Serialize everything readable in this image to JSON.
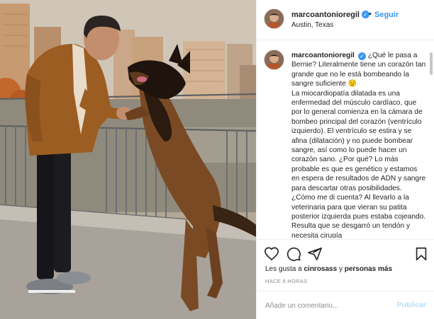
{
  "post": {
    "username": "marcoantonioregil",
    "follow_label": "Seguir",
    "separator": "•",
    "location": "Austin, Texas",
    "caption_parts": [
      "¿Qué le pasa a Bernie? Literalmente tiene un corazón tan grande que no le está bombeando la sangre suficiente 😟",
      "La miocardiopatía dilatada es una enfermedad del músculo cardíaco, que por lo general comienza en la cámara de bombeo principal del corazón (ventrículo izquierdo). El ventrículo se estira y se afina (dilatación) y no puede bombear sangre, así como lo puede hacer un corazón sano. ¿Por qué? Lo más probable es que es genético y estamos en espera de resultados de ADN y sangre para descartar otras posibilidades. ¿Cómo me di cuenta? Al llevarlo a la veterinaria para que vieran su patita posterior izquierda pues estaba cojeando. Resulta que se desgarró un tendón y necesita cirugía"
    ],
    "likes_prefix": "Les gusta a ",
    "likes_user": "cinrosass",
    "likes_middle": " y ",
    "likes_others": "personas más",
    "time_ago": "HACE 8 HORAS",
    "comment_placeholder": "Añade un comentario...",
    "publish_label": "Publicar"
  },
  "icons": {
    "verified": "verified-badge-icon",
    "like": "heart-icon",
    "comment": "comment-icon",
    "share": "share-icon",
    "save": "bookmark-icon"
  },
  "colors": {
    "link_blue": "#3897f0",
    "publish_disabled": "#b2dffc",
    "meta_gray": "#8e8e8e"
  }
}
